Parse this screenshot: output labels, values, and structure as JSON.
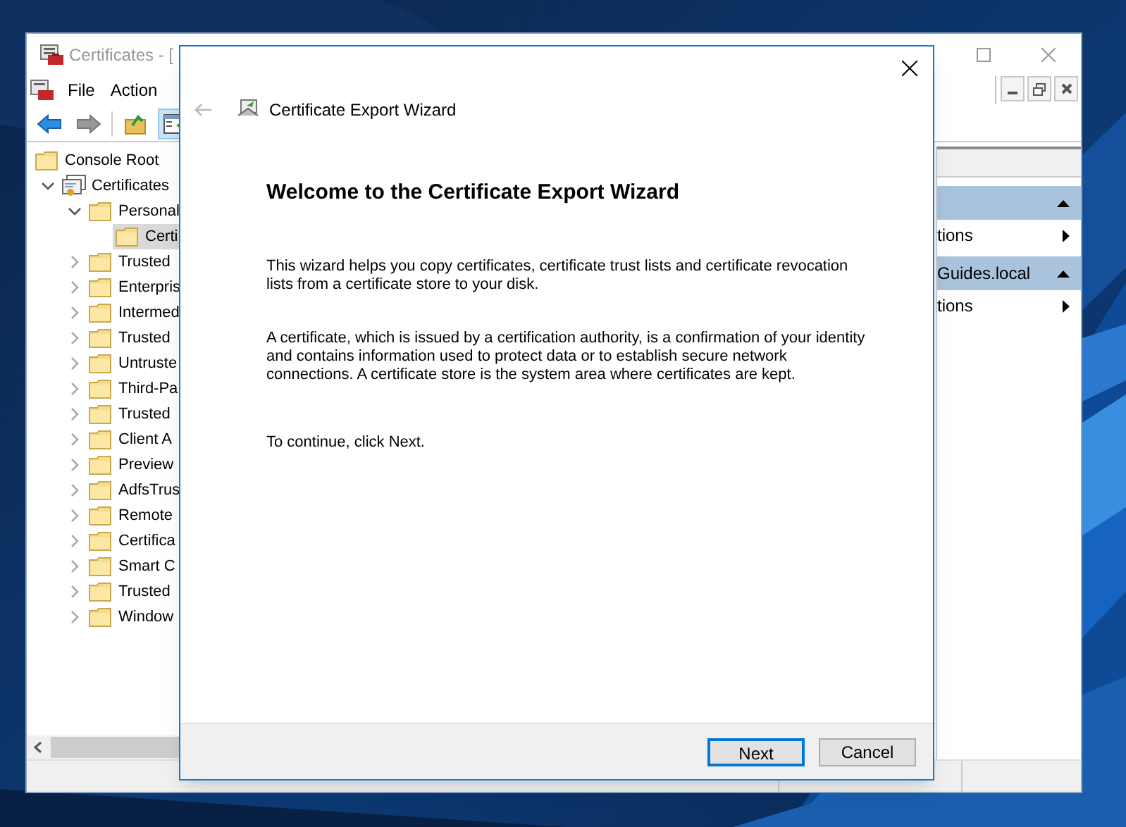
{
  "console": {
    "title": "Certificates - [",
    "menu": [
      "File",
      "Action"
    ],
    "toolbar": [
      {
        "kind": "back",
        "selected": false
      },
      {
        "kind": "forward",
        "selected": false
      },
      {
        "kind": "up",
        "selected": false
      },
      {
        "kind": "tree-toggle",
        "selected": true
      }
    ],
    "tree": [
      {
        "label": "Console Root",
        "kind": "folder",
        "selected": false,
        "children": [
          {
            "label": "Certificates",
            "kind": "store",
            "expanded": true,
            "selected": false,
            "children": [
              {
                "label": "Personal",
                "kind": "folder",
                "expanded": true,
                "selected": false,
                "children": [
                  {
                    "label": "Certi",
                    "kind": "folder",
                    "selected": true
                  }
                ]
              },
              {
                "label": "Trusted",
                "kind": "folder",
                "expanded": false,
                "selected": false
              },
              {
                "label": "Enterpris",
                "kind": "folder",
                "expanded": false,
                "selected": false
              },
              {
                "label": "Intermed",
                "kind": "folder",
                "expanded": false,
                "selected": false
              },
              {
                "label": "Trusted",
                "kind": "folder",
                "expanded": false,
                "selected": false
              },
              {
                "label": "Untruste",
                "kind": "folder",
                "expanded": false,
                "selected": false
              },
              {
                "label": "Third-Pa",
                "kind": "folder",
                "expanded": false,
                "selected": false
              },
              {
                "label": "Trusted",
                "kind": "folder",
                "expanded": false,
                "selected": false
              },
              {
                "label": "Client A",
                "kind": "folder",
                "expanded": false,
                "selected": false
              },
              {
                "label": "Preview",
                "kind": "folder",
                "expanded": false,
                "selected": false
              },
              {
                "label": "AdfsTrus",
                "kind": "folder",
                "expanded": false,
                "selected": false
              },
              {
                "label": "Remote",
                "kind": "folder",
                "expanded": false,
                "selected": false
              },
              {
                "label": "Certifica",
                "kind": "folder",
                "expanded": false,
                "selected": false
              },
              {
                "label": "Smart C",
                "kind": "folder",
                "expanded": false,
                "selected": false
              },
              {
                "label": "Trusted",
                "kind": "folder",
                "expanded": false,
                "selected": false
              },
              {
                "label": "Window",
                "kind": "folder",
                "expanded": false,
                "selected": false
              }
            ]
          }
        ]
      }
    ],
    "actions": [
      {
        "items": [
          "tions"
        ]
      },
      {
        "title": "Guides.local",
        "items": [
          "tions"
        ]
      }
    ]
  },
  "wizard": {
    "title": "Certificate Export Wizard",
    "heading": "Welcome to the Certificate Export Wizard",
    "paragraphs": [
      "This wizard helps you copy certificates, certificate trust lists and certificate revocation lists from a certificate store to your disk.",
      "A certificate, which is issued by a certification authority, is a confirmation of your identity and contains information used to protect data or to establish secure network connections. A certificate store is the system area where certificates are kept.",
      "To continue, click Next."
    ],
    "buttons": [
      {
        "label": "Next",
        "default": true
      },
      {
        "label": "Cancel",
        "default": false
      }
    ]
  }
}
